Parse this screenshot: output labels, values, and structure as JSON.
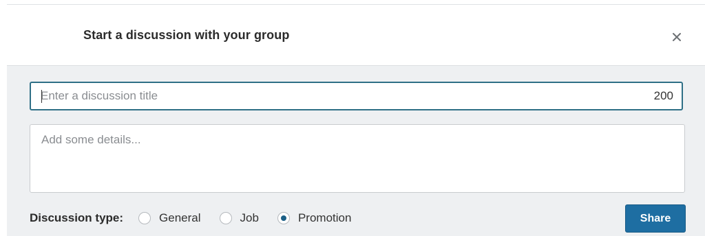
{
  "dialog": {
    "title": "Start a discussion with your group",
    "close_icon": "close-icon"
  },
  "form": {
    "title_field": {
      "placeholder": "Enter a discussion title",
      "value": "",
      "char_counter": "200"
    },
    "details_field": {
      "placeholder": "Add some details...",
      "value": ""
    },
    "discussion_type": {
      "label": "Discussion type:",
      "options": [
        {
          "label": "General",
          "selected": false
        },
        {
          "label": "Job",
          "selected": false
        },
        {
          "label": "Promotion",
          "selected": true
        }
      ]
    },
    "share_label": "Share"
  },
  "colors": {
    "accent": "#1e6ea2",
    "focus_border": "#2e6f86",
    "panel_background": "#eef0f2"
  }
}
